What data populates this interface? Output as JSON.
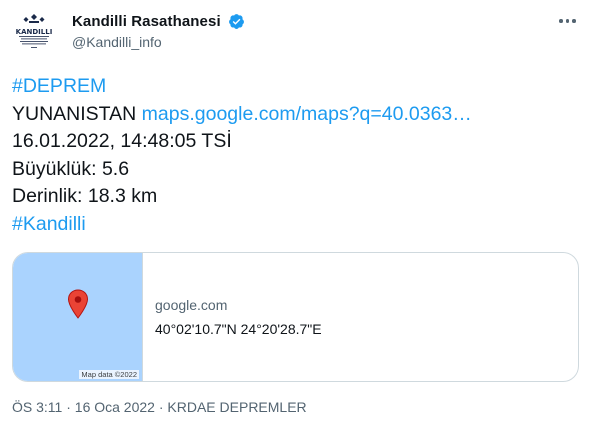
{
  "account": {
    "display_name": "Kandilli Rasathanesi",
    "handle": "@Kandilli_info",
    "verified": true,
    "avatar_logo_text": "KANDILLI RASATHANESİ VE DEPREM ARAŞTIRMA ENSTİTÜSÜ"
  },
  "tweet": {
    "hashtag_top": "#DEPREM",
    "location": "YUNANISTAN",
    "map_link": "maps.google.com/maps?q=40.0363…",
    "datetime": "16.01.2022, 14:48:05 TSİ",
    "magnitude": "Büyüklük: 5.6",
    "depth": "Derinlik: 18.3 km",
    "hashtag_bottom": "#Kandilli"
  },
  "card": {
    "domain": "google.com",
    "title": "40°02'10.7\"N 24°20'28.7\"E",
    "map_credit": "Map data ©2022",
    "map_color": "#aad3fe",
    "pin_color": "#ea4335"
  },
  "meta": {
    "time": "ÖS 3:11",
    "separator": "·",
    "date": "16 Oca 2022",
    "source": "KRDAE DEPREMLER"
  },
  "colors": {
    "link": "#1d9bf0",
    "text": "#0f1419",
    "secondary": "#536471",
    "verified": "#1d9bf0"
  },
  "icons": {
    "verified": "verified-badge-icon",
    "more": "more-options-icon",
    "pin": "map-pin-icon"
  }
}
